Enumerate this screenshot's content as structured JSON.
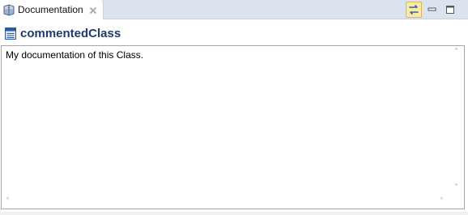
{
  "tab": {
    "label": "Documentation",
    "icon": "documentation-book-icon",
    "close_icon": "close-icon"
  },
  "toolbar": {
    "link_icon": "link-with-editor-icon",
    "minimize_icon": "minimize-icon",
    "maximize_icon": "maximize-icon"
  },
  "header": {
    "title": "commentedClass",
    "icon": "class-icon"
  },
  "editor": {
    "text": "My documentation of this Class."
  },
  "scrollbars": {
    "up": "˄",
    "down": "˅",
    "left": "˂",
    "right": "˃"
  },
  "colors": {
    "tabbar_bg": "#dbe3ef",
    "title_color": "#1d3c6e",
    "link_active_bg": "#f9e9a9"
  }
}
